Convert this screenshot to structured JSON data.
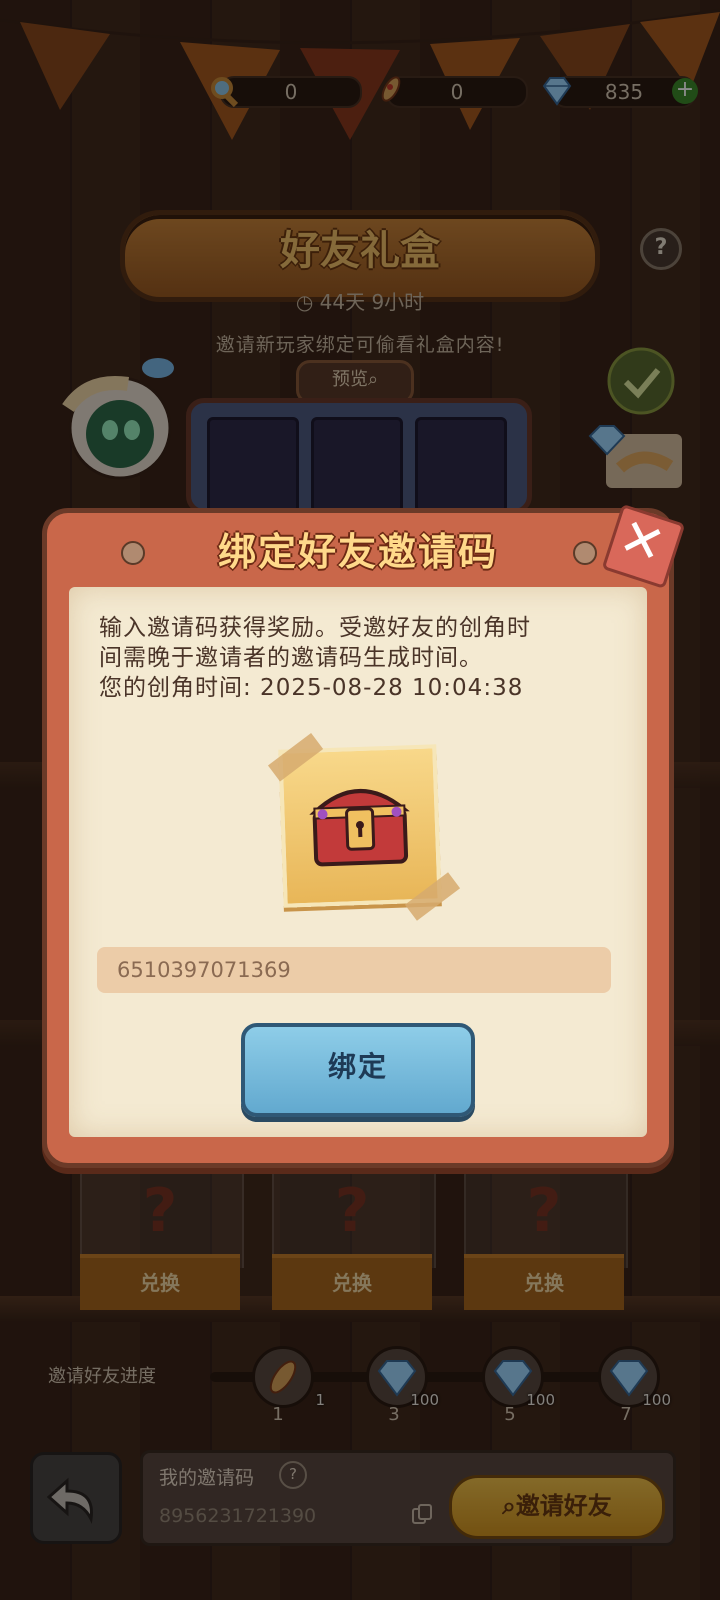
{
  "resources": [
    {
      "icon": "magnifier-icon",
      "value": "0"
    },
    {
      "icon": "rocket-icon",
      "value": "0"
    },
    {
      "icon": "diamond-icon",
      "value": "835"
    }
  ],
  "add_label": "+",
  "event": {
    "title": "好友礼盒",
    "timer": "44天 9小时",
    "hint": "邀请新玩家绑定可偷看礼盒内容!",
    "preview_label": "预览",
    "help": "?"
  },
  "prizes": [
    {
      "label": "?",
      "button": "兑换"
    },
    {
      "label": "?",
      "button": "兑换"
    },
    {
      "label": "?",
      "button": "兑换"
    }
  ],
  "progress": {
    "label": "邀请好友进度",
    "milestones": [
      {
        "icon": "rocket-icon",
        "reward": "1",
        "step": "1"
      },
      {
        "icon": "diamond-icon",
        "reward": "100",
        "step": "3"
      },
      {
        "icon": "diamond-icon",
        "reward": "100",
        "step": "5"
      },
      {
        "icon": "diamond-icon",
        "reward": "100",
        "step": "7"
      }
    ]
  },
  "my_code": {
    "title": "我的邀请码",
    "help": "?",
    "value": "8956231721390",
    "invite_label": "邀请好友"
  },
  "modal": {
    "title": "绑定好友邀请码",
    "line1": "输入邀请码获得奖励。受邀好友的创角时",
    "line2": "间需晚于邀请者的邀请码生成时间。",
    "line3": "您的创角时间: 2025-08-28 10:04:38",
    "input_value": "6510397071369",
    "bind_label": "绑定",
    "close_label": "✕"
  },
  "colors": {
    "accent": "#c9674a",
    "bind": "#62a9cf",
    "gold": "#f0c04a"
  }
}
